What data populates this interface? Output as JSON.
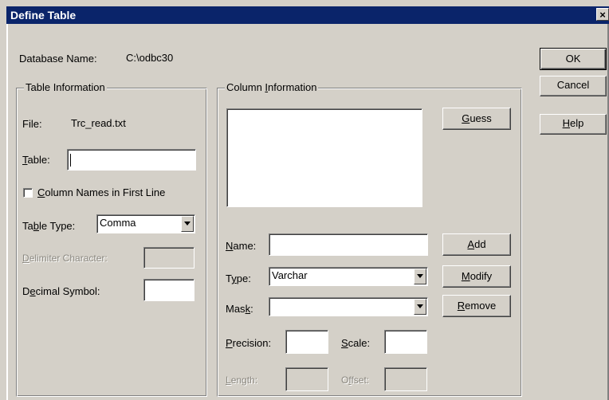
{
  "window": {
    "title": "Define Table",
    "close_glyph": "×"
  },
  "database": {
    "label": "Database Name:",
    "value": "C:\\odbc30"
  },
  "buttons": {
    "ok": "OK",
    "cancel": "Cancel",
    "help_pre": "",
    "help_key": "H",
    "help_post": "elp"
  },
  "table_info": {
    "legend": "Table Information",
    "file_label": "File:",
    "file_value": "Trc_read.txt",
    "table_label_key": "T",
    "table_label_post": "able:",
    "table_value": "",
    "colnames_key": "C",
    "colnames_post": "olumn Names in First Line",
    "colnames_checked": false,
    "type_label_pre": "Ta",
    "type_label_key": "b",
    "type_label_post": "le Type:",
    "type_value": "Comma",
    "delim_label_pre": "",
    "delim_label_key": "D",
    "delim_label_post": "elimiter Character:",
    "decimal_label_pre": "D",
    "decimal_label_key": "e",
    "decimal_label_post": "cimal Symbol:"
  },
  "column_info": {
    "legend_pre": "Column ",
    "legend_key": "I",
    "legend_post": "nformation",
    "guess_key": "G",
    "guess_post": "uess",
    "name_label_key": "N",
    "name_label_post": "ame:",
    "type_label_pre": "T",
    "type_label_key": "y",
    "type_label_post": "pe:",
    "type_value": "Varchar",
    "mask_label_pre": "Mas",
    "mask_label_key": "k",
    "mask_label_post": ":",
    "mask_value": "",
    "add_key": "A",
    "add_post": "dd",
    "modify_key": "M",
    "modify_post": "odify",
    "remove_key": "R",
    "remove_post": "emove",
    "precision_key": "P",
    "precision_post": "recision:",
    "scale_key": "S",
    "scale_post": "cale:",
    "length_key": "L",
    "length_post": "ength:",
    "offset_pre": "O",
    "offset_key": "f",
    "offset_post": "fset:"
  }
}
